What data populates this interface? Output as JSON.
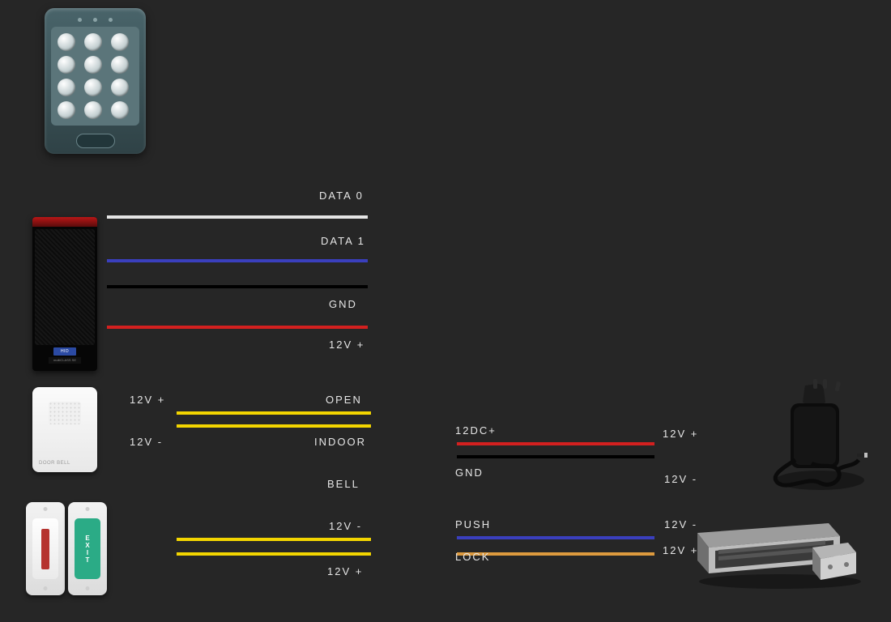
{
  "reader_wires": {
    "data0": "DATA 0",
    "data1": "DATA 1",
    "gnd": "GND",
    "v12p": "12V +"
  },
  "bell_wires": {
    "left_top": "12V +",
    "left_bottom": "12V -",
    "right_top": "OPEN",
    "right_bottom": "INDOOR",
    "bell": "BELL"
  },
  "exit_wires": {
    "top": "12V -",
    "bottom": "12V +"
  },
  "psu_wires": {
    "left_top": "12DC+",
    "left_bottom": "GND",
    "right_top": "12V +",
    "right_bottom": "12V -"
  },
  "lock_wires": {
    "left_top": "PUSH",
    "left_bottom": "LOCK",
    "right_top": "12V -",
    "right_bottom": "12V +"
  },
  "devices": {
    "reader_brand": "HID",
    "reader_model": "multiCLASS SE",
    "doorbell_label": "DOOR BELL",
    "exit_button_text": "EXIT"
  },
  "colors": {
    "wire_white": "#e4e4e4",
    "wire_blue": "#3a3fbd",
    "wire_black": "#000000",
    "wire_red": "#d3201f",
    "wire_yellow": "#f3d500",
    "wire_orange": "#dd9a3e"
  }
}
